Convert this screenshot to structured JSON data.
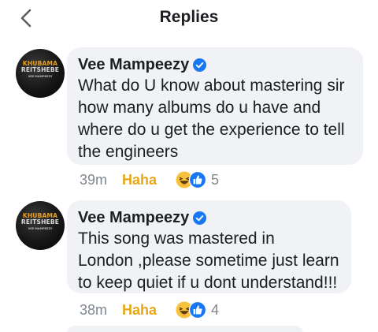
{
  "header": {
    "title": "Replies",
    "back_icon": "chevron-left-icon"
  },
  "colors": {
    "bubble_bg": "#f0f2f5",
    "verified_blue": "#1877f2",
    "haha_yellow": "#e6a817",
    "meta_gray": "#7f8790"
  },
  "comments": [
    {
      "author": "Vee Mampeezy",
      "verified": true,
      "avatar": {
        "line1": "KHUBAMA",
        "line2": "REITSHEBE",
        "line3": "VEE MAMPEEZY"
      },
      "text_lines": [
        "What do U know about mastering sir",
        "how many albums do u have and",
        "where do u get the experience to tell",
        "the engineers"
      ],
      "time": "39m",
      "reaction_label": "Haha",
      "reaction_icons": [
        "haha-emoji-icon",
        "like-icon"
      ],
      "reaction_count": "5"
    },
    {
      "author": "Vee Mampeezy",
      "verified": true,
      "avatar": {
        "line1": "KHUBAMA",
        "line2": "REITSHEBE",
        "line3": "VEE MAMPEEZY"
      },
      "text_lines": [
        "This song was mastered in",
        "London ,please sometime just learn",
        "to keep quiet if u dont understand!!!"
      ],
      "time": "38m",
      "reaction_label": "Haha",
      "reaction_icons": [
        "haha-emoji-icon",
        "like-icon"
      ],
      "reaction_count": "4"
    }
  ]
}
